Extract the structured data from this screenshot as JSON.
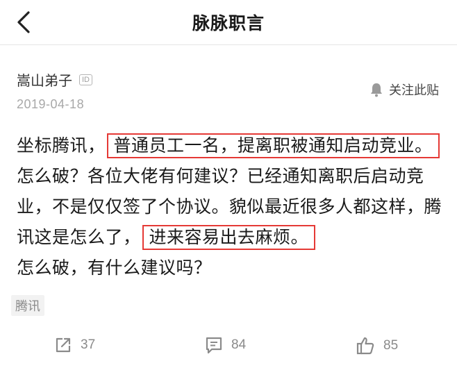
{
  "header": {
    "title": "脉脉职言",
    "back_icon": "chevron-left-icon"
  },
  "post": {
    "author": "嵩山弟子",
    "id_badge": "ID",
    "date": "2019-04-18",
    "follow_label": "关注此贴",
    "follow_icon": "bell-icon",
    "content": {
      "p1": "坐标腾讯，",
      "h1": "普通员工一名，提离职被通知启动竞业。",
      "p2": "怎么破？各位大佬有何建议？已经通知离职后启动竞业，不是仅仅签了个协议。貌似最近很多人都这样，腾讯这是怎么了，",
      "h2": "进来容易出去麻烦。",
      "p3": "怎么破，有什么建议吗？"
    },
    "highlight_color": "#e53935",
    "tag": "腾讯"
  },
  "actions": {
    "share": {
      "icon": "share-icon",
      "count": "37"
    },
    "comment": {
      "icon": "comment-icon",
      "count": "84"
    },
    "like": {
      "icon": "thumbs-up-icon",
      "count": "85"
    }
  }
}
